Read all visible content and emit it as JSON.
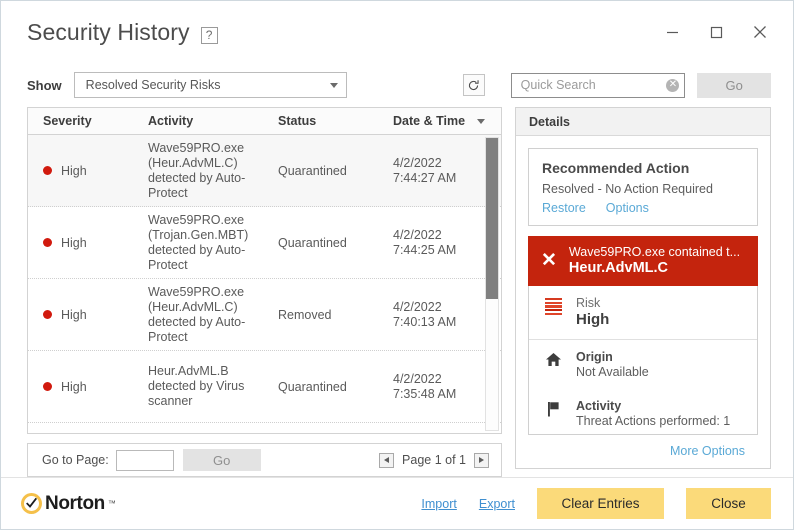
{
  "window": {
    "title": "Security History",
    "help_badge": "?",
    "controls": {
      "minimize": "minimize-icon",
      "maximize": "maximize-icon",
      "close": "close-icon"
    }
  },
  "toolbar": {
    "show_label": "Show",
    "filter_value": "Resolved Security Risks",
    "refresh_icon": "refresh-icon",
    "search_placeholder": "Quick Search",
    "search_value": "",
    "clear_icon": "clear-icon",
    "go_label": "Go"
  },
  "grid": {
    "columns": [
      "Severity",
      "Activity",
      "Status",
      "Date & Time"
    ],
    "sort_column": "Date & Time",
    "rows": [
      {
        "severity": "High",
        "activity": "Wave59PRO.exe (Heur.AdvML.C) detected by Auto-Protect",
        "status": "Quarantined",
        "date": "4/2/2022",
        "time": "7:44:27 AM",
        "selected": true
      },
      {
        "severity": "High",
        "activity": "Wave59PRO.exe (Trojan.Gen.MBT) detected by Auto-Protect",
        "status": "Quarantined",
        "date": "4/2/2022",
        "time": "7:44:25 AM",
        "selected": false
      },
      {
        "severity": "High",
        "activity": "Wave59PRO.exe (Heur.AdvML.C) detected by Auto-Protect",
        "status": "Removed",
        "date": "4/2/2022",
        "time": "7:40:13 AM",
        "selected": false
      },
      {
        "severity": "High",
        "activity": "Heur.AdvML.B detected by Virus scanner",
        "status": "Quarantined",
        "date": "4/2/2022",
        "time": "7:35:48 AM",
        "selected": false
      }
    ]
  },
  "pager": {
    "goto_label": "Go to Page:",
    "goto_value": "",
    "go_label": "Go",
    "page_status": "Page 1 of 1",
    "prev_icon": "chevron-left-icon",
    "next_icon": "chevron-right-icon"
  },
  "details": {
    "header": "Details",
    "recommended": {
      "title": "Recommended Action",
      "status": "Resolved - No Action Required",
      "restore_link": "Restore",
      "options_link": "Options"
    },
    "alert": {
      "icon": "alert-x-icon",
      "line1": "Wave59PRO.exe contained t...",
      "line2": "Heur.AdvML.C",
      "color": "#c4240d"
    },
    "meta": [
      {
        "icon": "risk-bars-icon",
        "key": "Risk",
        "value": "High",
        "emphasis": "value"
      },
      {
        "icon": "home-icon",
        "key": "Origin",
        "value": "Not Available",
        "emphasis": "key"
      },
      {
        "icon": "flag-icon",
        "key": "Activity",
        "value": "Threat Actions performed: 1",
        "emphasis": "key"
      }
    ],
    "more_options": "More Options"
  },
  "footer": {
    "logo_text": "Norton",
    "logo_tm": "™",
    "import_link": "Import",
    "export_link": "Export",
    "clear_button": "Clear Entries",
    "close_button": "Close",
    "accent": "#fbda7a"
  }
}
